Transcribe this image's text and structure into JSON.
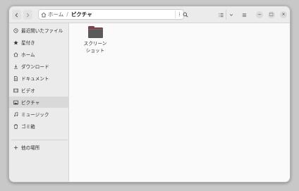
{
  "headerbar": {
    "path": {
      "home_label": "ホーム",
      "separator": "/",
      "current_label": "ピクチャ"
    },
    "icons": {
      "back": "chevron-left-icon",
      "forward": "chevron-right-icon",
      "home": "home-icon",
      "path_menu": "vertical-ellipsis-icon",
      "search": "search-icon",
      "view_list": "list-view-icon",
      "view_dropdown": "chevron-down-icon",
      "main_menu": "hamburger-menu-icon"
    },
    "window_controls": {
      "minimize": "−",
      "maximize": "□",
      "close": "×"
    }
  },
  "sidebar": {
    "items": [
      {
        "label": "最近開いたファイル",
        "icon": "recent-icon"
      },
      {
        "label": "星付き",
        "icon": "star-icon"
      },
      {
        "label": "ホーム",
        "icon": "home-icon"
      },
      {
        "label": "ダウンロード",
        "icon": "download-icon"
      },
      {
        "label": "ドキュメント",
        "icon": "document-icon"
      },
      {
        "label": "ビデオ",
        "icon": "video-icon"
      },
      {
        "label": "ピクチャ",
        "icon": "picture-icon",
        "selected": true
      },
      {
        "label": "ミュージック",
        "icon": "music-icon"
      },
      {
        "label": "ゴミ箱",
        "icon": "trash-icon"
      }
    ],
    "other_locations": {
      "label": "他の場所",
      "icon": "plus-icon"
    }
  },
  "content": {
    "files": [
      {
        "name": "スクリーン\nショット",
        "type": "folder",
        "icon": "folder-icon"
      }
    ]
  },
  "colors": {
    "folder_accent": "#8a3a4a",
    "folder_body": "#5a5a5a",
    "sidebar_bg": "#ebebeb",
    "content_bg": "#fafafa",
    "selected_bg": "#d9d9d9"
  }
}
